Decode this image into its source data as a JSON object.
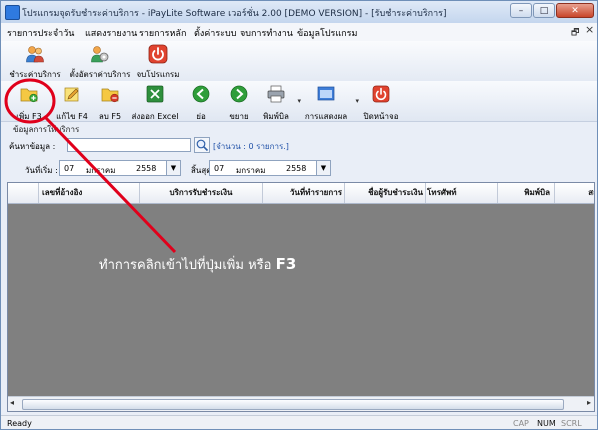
{
  "window": {
    "title": "โปรแกรมจุดรับชำระค่าบริการ - iPayLite Software เวอร์ชั่น 2.00 [DEMO VERSION] - [รับชำระค่าบริการ]",
    "btn_minimize": "–",
    "btn_maximize": "□",
    "btn_close": "✕"
  },
  "menubar": {
    "items": [
      "รายการประจำวัน",
      "แสดงรายงาน",
      "รายการหลัก",
      "ตั้งค่าระบบ",
      "จบการทำงาน",
      "ข้อมูลโปรแกรม"
    ],
    "mdi_restore": "🗗",
    "mdi_close": "×"
  },
  "ribbon": {
    "items": [
      "ชำระค่าบริการ",
      "ตั้งอัตราค่าบริการ",
      "จบโปรแกรม"
    ]
  },
  "toolbar": {
    "add": "เพิ่ม F3",
    "edit": "แก้ไข F4",
    "delete": "ลบ F5",
    "export": "ส่งออก Excel",
    "prev": "ย่อ",
    "next": "ขยาย",
    "print": "พิมพ์บิล",
    "display": "การแสดงผล",
    "close": "ปิดหน้าจอ",
    "dropdown": "▾"
  },
  "filters": {
    "section_title": "ข้อมูลการให้บริการ",
    "search_label": "ค้นหาข้อมูล :",
    "search_value": "",
    "count_text": "[จำนวน : 0 รายการ.]",
    "from_label": "วันที่เริ่ม :",
    "to_label": "สิ้นสุด",
    "from_date": {
      "day": "07",
      "month": "มกราคม",
      "year": "2558"
    },
    "to_date": {
      "day": "07",
      "month": "มกราคม",
      "year": "2558"
    },
    "dropdown_arrow": "▼"
  },
  "grid": {
    "columns": [
      "เลขที่อ้างอิง",
      "บริการรับชำระเงิน",
      "วันที่ทำรายการ",
      "ชื่อผู้รับชำระเงิน",
      "โทรศัพท์",
      "พิมพ์บิล",
      "สถ"
    ],
    "scroll_left": "◂",
    "scroll_right": "▸"
  },
  "statusbar": {
    "text": "Ready",
    "cap": "CAP",
    "num": "NUM",
    "scrl": "SCRL"
  },
  "annotation": {
    "text": "ทำการคลิกเข้าไปที่ปุ่มเพิ่ม หรือ",
    "key": "F3",
    "color": "#e0001b"
  }
}
